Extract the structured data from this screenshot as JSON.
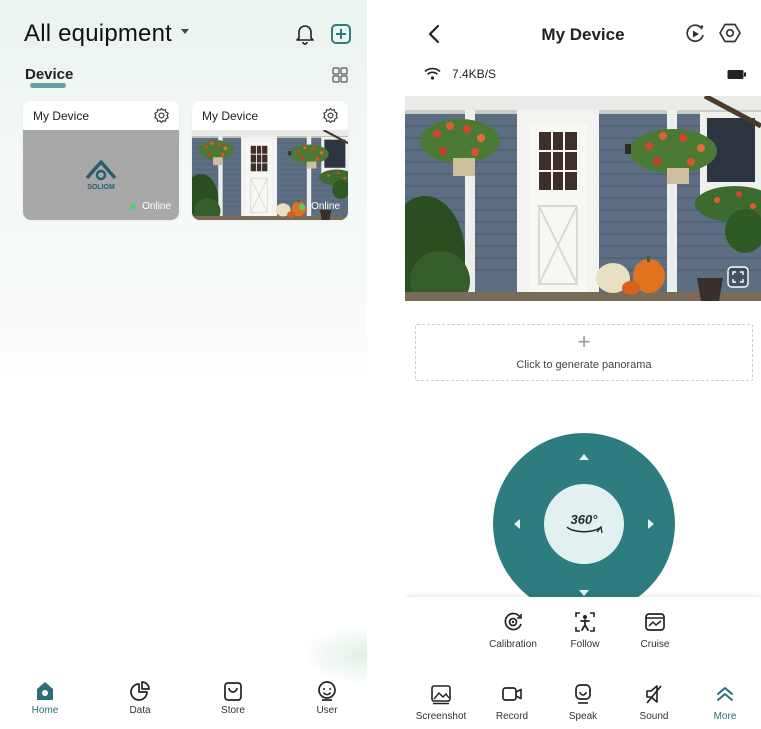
{
  "home": {
    "title": "All equipment",
    "section": "Device",
    "devices": [
      {
        "name": "My Device",
        "status": "Online",
        "logo_text": "SOLIOM"
      },
      {
        "name": "My Device",
        "status": "Online"
      }
    ],
    "tabs": [
      {
        "label": "Home",
        "icon": "home-icon",
        "active": true
      },
      {
        "label": "Data",
        "icon": "pie-chart-icon"
      },
      {
        "label": "Store",
        "icon": "shopping-bag-icon"
      },
      {
        "label": "User",
        "icon": "user-icon"
      }
    ]
  },
  "device": {
    "title": "My Device",
    "speed": "7.4KB/S",
    "panorama_label": "Click to generate panorama",
    "ptz_label": "360°",
    "controls_row1": [
      {
        "label": "Calibration",
        "icon": "calibration-icon"
      },
      {
        "label": "Follow",
        "icon": "follow-icon"
      },
      {
        "label": "Cruise",
        "icon": "cruise-icon"
      }
    ],
    "controls_row2": [
      {
        "label": "Screenshot",
        "icon": "screenshot-icon"
      },
      {
        "label": "Record",
        "icon": "record-icon"
      },
      {
        "label": "Speak",
        "icon": "speak-icon"
      },
      {
        "label": "Sound",
        "icon": "sound-off-icon"
      },
      {
        "label": "More",
        "icon": "more-icon",
        "active": true
      }
    ]
  },
  "colors": {
    "accent": "#2d7c80",
    "active_tab": "#2a6e7a",
    "online": "#4fd06a"
  }
}
